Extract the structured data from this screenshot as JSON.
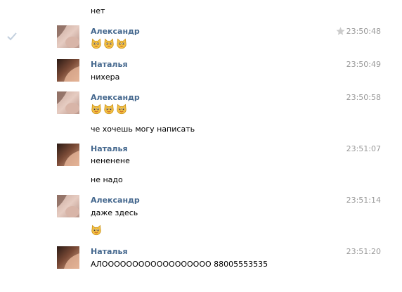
{
  "messages": {
    "top_text": "нет",
    "m1": {
      "author": "Александр",
      "time": "23:50:48"
    },
    "m2": {
      "author": "Наталья",
      "time": "23:50:49",
      "text": "нихера"
    },
    "m3": {
      "author": "Александр",
      "time": "23:50:58",
      "text2": "че хочешь могу написать"
    },
    "m4": {
      "author": "Наталья",
      "time": "23:51:07",
      "text": "нененене",
      "text2": "не надо"
    },
    "m5": {
      "author": "Александр",
      "time": "23:51:14",
      "text": "даже здесь"
    },
    "m6": {
      "author": "Наталья",
      "time": "23:51:20",
      "text": "АЛОООООООООООООООООО 88005553535"
    }
  },
  "icons": {
    "read_check": "check-icon",
    "favorite": "star-icon",
    "emoji": "cat-face-emoji"
  },
  "colors": {
    "author_name": "#45688e",
    "timestamp": "#999999",
    "check": "#c3d0de",
    "star": "#cccccc",
    "emoji_fill": "#f6c343",
    "emoji_outline": "#c8901a"
  }
}
